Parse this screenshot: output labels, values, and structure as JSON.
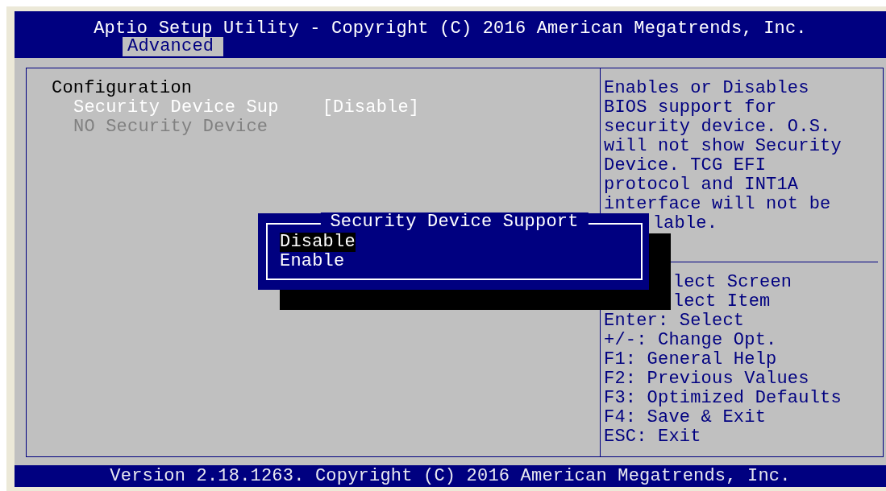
{
  "header": {
    "title": "Aptio Setup Utility - Copyright (C) 2016 American Megatrends, Inc.",
    "tabs": [
      {
        "label": "Advanced",
        "selected": true
      }
    ]
  },
  "settings": [
    {
      "kind": "heading",
      "label": "Configuration"
    },
    {
      "kind": "option",
      "label": "Security Device Sup",
      "value": "[Disable]",
      "selected": true,
      "disabled": false
    },
    {
      "kind": "option",
      "label": "NO Security Device",
      "selected": false,
      "disabled": true
    }
  ],
  "help": {
    "description": [
      {
        "kind": "full",
        "text": "Enables or Disables"
      },
      {
        "kind": "full",
        "text": "BIOS support for"
      },
      {
        "kind": "full",
        "text": "security device. O.S."
      },
      {
        "kind": "full",
        "text": "will not show Security"
      },
      {
        "kind": "full",
        "text": "Device. TCG EFI"
      },
      {
        "kind": "full",
        "text": "protocol and INT1A"
      },
      {
        "kind": "full",
        "text": "interface will not be"
      },
      {
        "kind": "covered",
        "text": "lable."
      }
    ],
    "keys": [
      {
        "kind": "covered",
        "text": "lect Screen"
      },
      {
        "kind": "covered",
        "text": "lect Item"
      },
      {
        "kind": "full",
        "text": "Enter: Select"
      },
      {
        "kind": "full",
        "text": "+/-: Change Opt."
      },
      {
        "kind": "full",
        "text": "F1: General Help"
      },
      {
        "kind": "full",
        "text": "F2: Previous Values"
      },
      {
        "kind": "full",
        "text": "F3: Optimized Defaults"
      },
      {
        "kind": "full",
        "text": "F4: Save & Exit"
      },
      {
        "kind": "full",
        "text": "ESC: Exit"
      }
    ]
  },
  "popup": {
    "title": "Security Device Support",
    "options": [
      {
        "label": "Disable",
        "selected": true
      },
      {
        "label": "Enable",
        "selected": false
      }
    ]
  },
  "footer": {
    "text": "Version 2.18.1263. Copyright (C) 2016 American Megatrends, Inc."
  }
}
